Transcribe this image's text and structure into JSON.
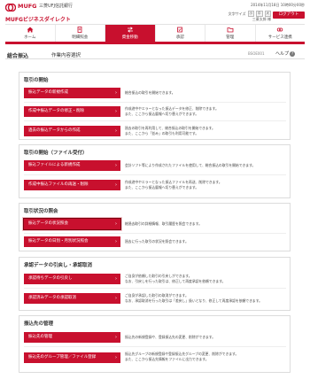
{
  "header": {
    "bank_name": "MUFG",
    "bank_sub": "三菱UFJ信託銀行",
    "brand": "MUFGビジネスダイレクト",
    "datetime": "2014年11月18日 10時00分00秒",
    "font_size_label": "文字サイズ",
    "font_sizes": [
      "小",
      "中",
      "大"
    ],
    "user": "三菱太郎 様",
    "logout_label": "ログアウト"
  },
  "nav": [
    {
      "label": "ホーム",
      "icon": "home-icon",
      "active": false
    },
    {
      "label": "明細照会",
      "icon": "document-icon",
      "active": false
    },
    {
      "label": "資金移動",
      "icon": "transfer-icon",
      "active": true
    },
    {
      "label": "承認",
      "icon": "stamp-icon",
      "active": false
    },
    {
      "label": "管理",
      "icon": "folder-icon",
      "active": false
    },
    {
      "label": "サービス連携",
      "icon": "link-icon",
      "active": false
    }
  ],
  "page": {
    "title": "総合振込",
    "subtitle": "作業内容選択",
    "screen_id": "BSOE001",
    "help": "ヘルプ"
  },
  "sections": [
    {
      "title": "取引の開始",
      "items": [
        {
          "label": "振込データの新規作成",
          "desc": [
            "総合振込の取引を開始できます。"
          ]
        },
        {
          "label": "作成中振込データの修正・削除",
          "desc": [
            "作成途中やエラーとなった振込データを修正、削除できます。",
            "また、ここから振込暦報へ切り替えができます。"
          ]
        },
        {
          "label": "過去の振込データからの作成",
          "desc": [
            "過去の取引を再利用して、総合振込の取引を開始できます。",
            "また、ここから「並み」の取引も利用可能です。"
          ]
        }
      ]
    },
    {
      "title": "取引の開始（ファイル受付）",
      "items": [
        {
          "label": "振込ファイルによる新規作成",
          "desc": [
            "会計ソフト等により作成されたファイルを使用して、総合振込の取引を開始できます。"
          ]
        },
        {
          "label": "作成中振込ファイルの再送・削除",
          "desc": [
            "作成途中やエラーとなった振込ファイルを再送、削除できます。",
            "また、ここから振込暦報へ切り替えができます。"
          ]
        }
      ]
    },
    {
      "title": "取引状況の照会",
      "items": [
        {
          "label": "振込データの状況照会",
          "desc": [
            "総過去取引の詳細情報、取引履歴を照会できます。"
          ],
          "selected": true
        },
        {
          "label": "振込データの日別・月別状況照会",
          "desc": [
            "過去に行った取引の状況を照会できます。"
          ]
        }
      ]
    },
    {
      "title": "承認データの引戻し・承認取消",
      "items": [
        {
          "label": "承認待ちデータの引戻し",
          "desc": [
            "ご自身が依頼した取引の引戻しができます。",
            "なお、引戻しを行った取引は、修正して再度承認を依頼できます。"
          ]
        },
        {
          "label": "承認済みデータの承認取消",
          "desc": [
            "ご自身が承認した取引の取消ができます。",
            "なお、承認取消を行った取引は「差戻し」扱いとなり、修正して再度承認を依頼できます。"
          ]
        }
      ]
    },
    {
      "title": "振込先の管理",
      "items": [
        {
          "label": "振込先の管理",
          "desc": [
            "振込先の新規登録や、登録振込先の変更、削除ができます。"
          ]
        },
        {
          "label": "振込先のグループ管理／ファイル登録",
          "desc": [
            "振込先グループの新規登録や登録振込先グループの変更、削除ができます。",
            "また、ここから振込先情報をファイルに出力できます。"
          ]
        }
      ]
    }
  ],
  "colors": {
    "accent": "#c8102e"
  }
}
